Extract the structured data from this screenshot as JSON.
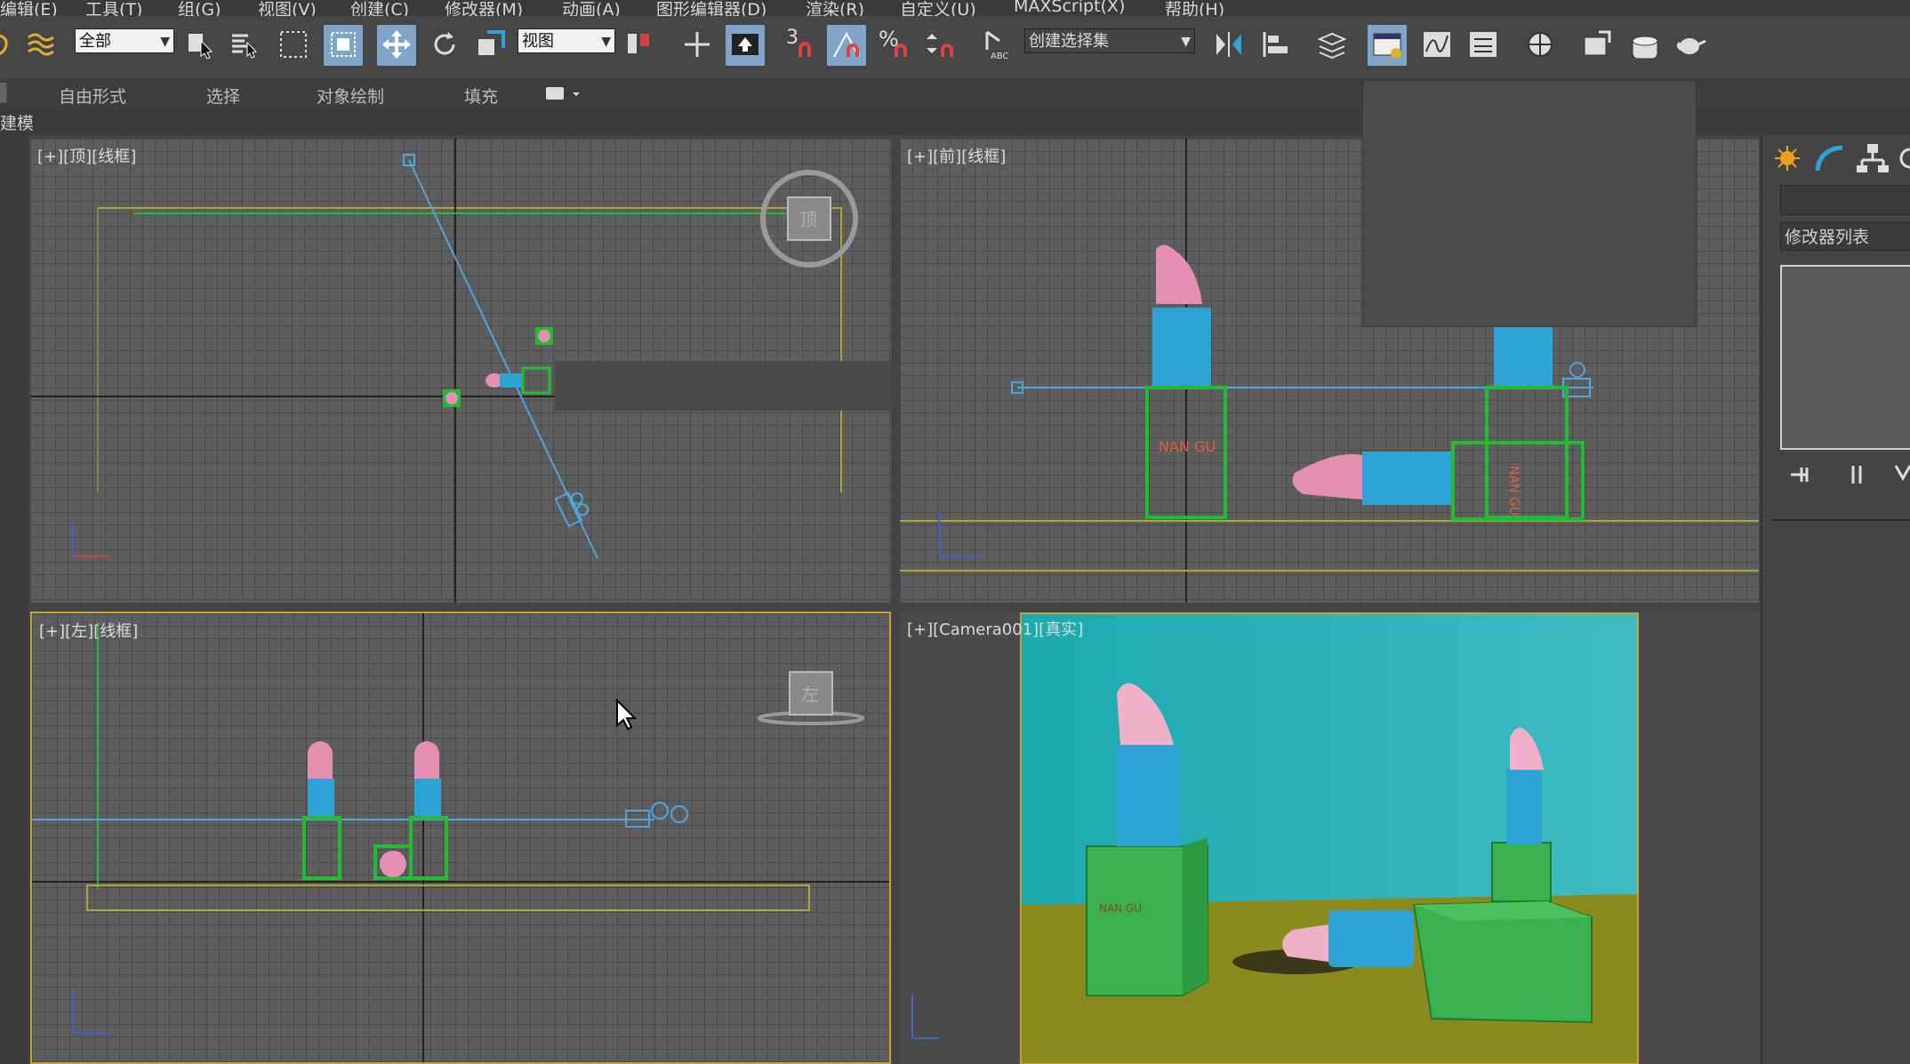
{
  "menu": [
    "编辑(E)",
    "工具(T)",
    "组(G)",
    "视图(V)",
    "创建(C)",
    "修改器(M)",
    "动画(A)",
    "图形编辑器(D)",
    "渲染(R)",
    "自定义(U)",
    "MAXScript(X)",
    "帮助(H)"
  ],
  "toolbar": {
    "filter_dropdown": "全部",
    "coord_dropdown": "视图",
    "selection_set_dropdown": "创建选择集",
    "snap_label": "3",
    "percent_snap": "%"
  },
  "ribbon": {
    "tabs": [
      "自由形式",
      "选择",
      "对象绘制",
      "填充"
    ],
    "sub_label": "建模"
  },
  "viewports": {
    "top_label": "[+][顶][线框]",
    "front_label": "[+][前][线框]",
    "left_label": "[+][左][线框]",
    "camera_label_a": "[+][",
    "camera_label_b": "Camera001",
    "camera_label_c": "][真实]",
    "box_text_front_1": "NAN GU",
    "box_text_front_2": "NAN GU",
    "box_text_render": "NAN GU",
    "cube_face_left": "左",
    "cube_face_top": "顶"
  },
  "command_panel": {
    "modifier_list": "修改器列表"
  },
  "colors": {
    "background": "#444444",
    "grid_bg": "#5e5e5e",
    "active_border": "#c8a232",
    "toolbar_active": "#7fa6c9",
    "lipstick_pink": "#e58fb2",
    "lipstick_blue": "#2fa3d6",
    "box_green": "#22bb33",
    "camera_line": "#4da6e0",
    "render_sky": "#2fb3b8",
    "render_ground": "#8a8a1e"
  }
}
